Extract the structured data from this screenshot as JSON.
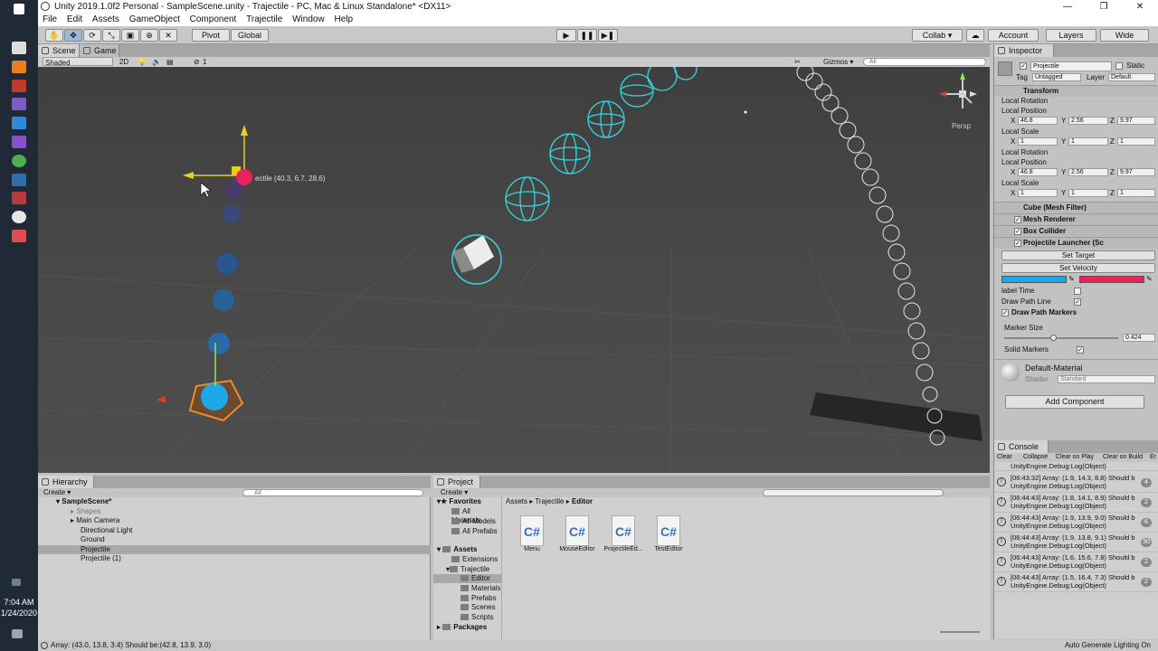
{
  "taskbar": {
    "time": "7:04 AM",
    "date": "1/24/2020"
  },
  "window": {
    "title": "Unity 2019.1.0f2 Personal - SampleScene.unity - Trajectile - PC, Mac & Linux Standalone* <DX11>",
    "minimize": "—",
    "maximize": "❐",
    "close": "✕"
  },
  "menu": [
    "File",
    "Edit",
    "Assets",
    "GameObject",
    "Component",
    "Trajectile",
    "Window",
    "Help"
  ],
  "toolbar": {
    "pivot": "Pivot",
    "global": "Global",
    "play": "▶",
    "pause": "❚❚",
    "step": "▶❚",
    "collab": "Collab ▾",
    "cloud": "☁",
    "account": "Account",
    "layers": "Layers",
    "layout": "Wide"
  },
  "scene": {
    "tabs": [
      "Scene",
      "Game"
    ],
    "shading": "Shaded",
    "mode2d": "2D",
    "gizmos": "Gizmos ▾",
    "search_placeholder": "All",
    "persp_label": "Persp",
    "hidden_count": "1",
    "object_label": "ectile (40.3, 6.7, 28.6)"
  },
  "inspector": {
    "tab": "Inspector",
    "object_name": "Projectile",
    "static_label": "Static",
    "tag_label": "Tag",
    "tag_value": "Untagged",
    "layer_label": "Layer",
    "layer_value": "Default",
    "transform": {
      "title": "Transform",
      "local_rotation": "Local Rotation",
      "local_position": "Local Position",
      "local_scale": "Local Scale",
      "position": {
        "x": "46.8",
        "y": "2.56",
        "z": "9.97"
      },
      "scale": {
        "x": "1",
        "y": "1",
        "z": "1"
      }
    },
    "components": [
      "Cube (Mesh Filter)",
      "Mesh Renderer",
      "Box Collider",
      "Projectile Launcher (Sc"
    ],
    "set_target": "Set Target",
    "set_velocity": "Set Velocity",
    "color_a": "#1fa8e8",
    "color_b": "#e8225a",
    "label_time": "label Time",
    "draw_path_line": "Draw Path Line",
    "draw_path_markers": "Draw Path Markers",
    "marker_size_label": "Marker Size",
    "marker_size_value": "0.424",
    "marker_size_fraction": 0.424,
    "solid_markers": "Solid Markers",
    "material_name": "Default-Material",
    "shader_label": "Shader",
    "shader_value": "Standard",
    "add_component": "Add Component"
  },
  "console": {
    "tab": "Console",
    "buttons": [
      "Clear",
      "Collapse",
      "Clear on Play",
      "Clear on Build",
      "Er"
    ],
    "entries": [
      {
        "line1": "[06:43:32] Array: (1.9, 14.3, 8.8) Should b",
        "line2": "UnityEngine.Debug:Log(Object)",
        "count": "4"
      },
      {
        "line1": "[06:44:43] Array: (1.8, 14.1, 8.9) Should b",
        "line2": "UnityEngine.Debug:Log(Object)",
        "count": "2"
      },
      {
        "line1": "[06:44:43] Array: (1.9, 13.9, 9.0) Should b",
        "line2": "UnityEngine.Debug:Log(Object)",
        "count": "6"
      },
      {
        "line1": "[06:44:43] Array: (1.9, 13.8, 9.1) Should b",
        "line2": "UnityEngine.Debug:Log(Object)",
        "count": "30"
      },
      {
        "line1": "[06:44:43] Array: (1.6, 15.6, 7.8) Should b",
        "line2": "UnityEngine.Debug:Log(Object)",
        "count": "2"
      },
      {
        "line1": "[06:44:43] Array: (1.5, 16.4, 7.3) Should b",
        "line2": "UnityEngine.Debug:Log(Object)",
        "count": "2"
      }
    ],
    "partial_line": "UnityEngine.Debug:Log(Object)"
  },
  "hierarchy": {
    "tab": "Hierarchy",
    "create": "Create ▾",
    "search_placeholder": "All",
    "scene": "SampleScene*",
    "items": [
      "Shapes",
      "Main Camera",
      "Directional Light",
      "Ground",
      "Projectile",
      "Projectile (1)"
    ]
  },
  "project": {
    "tab": "Project",
    "create": "Create ▾",
    "favorites": "Favorites",
    "favorite_items": [
      "All Materials",
      "All Models",
      "All Prefabs"
    ],
    "assets": "Assets",
    "asset_tree": [
      "Extensions",
      "Trajectile",
      "Editor",
      "Materials",
      "Prefabs",
      "Scenes",
      "Scripts"
    ],
    "packages": "Packages",
    "breadcrumb": [
      "Assets",
      "Trajectile",
      "Editor"
    ],
    "files": [
      "Menu",
      "MouseEditor",
      "ProjectileEd...",
      "TestEditor"
    ],
    "file_icon": "C#"
  },
  "status": {
    "message": "Array: (43.0, 13.8, 3.4) Should be:(42.8, 13.9, 3.0)",
    "right": "Auto Generate Lighting On"
  }
}
